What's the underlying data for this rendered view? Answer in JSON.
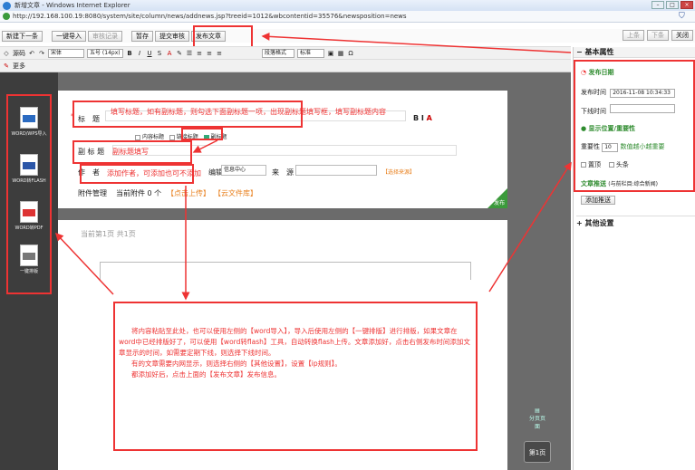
{
  "window": {
    "title": "新增文章 - Windows Internet Explorer",
    "url": "http://192.168.100.19:8080/system/site/column/news/addnews.jsp?treeid=1012&wbcontentid=35576&newsposition=news"
  },
  "toolbar": {
    "new_next": "新建下一条",
    "import": "一键导入",
    "view_record": "审核记录",
    "save_draft": "暂存",
    "submit_review": "提交审核",
    "publish": "发布文章",
    "prev": "上条",
    "next": "下条",
    "close": "关闭"
  },
  "editor_toolbar": {
    "source": "源码",
    "font": "宋体",
    "size": "五号 (14px)",
    "para": "段落格式",
    "style": "标准",
    "more": "更多"
  },
  "form": {
    "title_label": "标　题",
    "title_annotation": "填写标题，如有副标题，则勾选下面副标题一项，出现副标题填写框，填写副标题内容",
    "checks": [
      "内容标题",
      "链接标题",
      "副标题"
    ],
    "subtitle_label": "副 标 题",
    "subtitle_annotation": "副标题填写",
    "author_label": "作　者",
    "author_annotation": "添加作者，可添加也可不添加",
    "editor_label": "编辑",
    "editor_value": "信息中心",
    "source_label": "来　源",
    "choose_source": "【选择来源】",
    "attachment_label": "附件管理",
    "attachment_count": "当前附件 0 个",
    "upload": "【点击上传】",
    "cloud": "【云文件库】",
    "publish_corner": "发布"
  },
  "page_info": "当前第1页  共1页",
  "main_annotation": [
    "将内容粘贴至此处，也可以使用左侧的【word导入】，导入后使用左侧的【一键排版】进行排版，如果文章在word中已经排版好了，可以使用【word转flash】工具，自动转换flash上传。文章添加好，点击右侧发布时间添加文章显示的时间，如需要定期下线，则选择下线时间。",
    "有的文章需要内网显示，则选择右侧的【其他设置】，设置【ip规则】。",
    "都添加好后，点击上面的【发布文章】发布信息。"
  ],
  "side_tools": [
    "WORD/WPS导入",
    "WORD转FLASH",
    "WORD转PDF",
    "一键排版"
  ],
  "right": {
    "basic_props": "基本属性",
    "publish_date_title": "发布日期",
    "publish_time_label": "发布时间",
    "publish_time_value": "2016-11-08 10:34:33",
    "offline_label": "下线时间",
    "display_title": "显示位置/重要性",
    "importance_label": "重要性",
    "importance_value": "10",
    "importance_hint": "数值越小越重要",
    "top_label": "置顶",
    "headline_label": "头条",
    "push_title": "文章推送",
    "push_hint": "(与前栏目:综合新闻)",
    "add_push": "添加推送",
    "other": "其他设置"
  },
  "footer": {
    "pager_label": "分页页面",
    "page1": "第1页"
  },
  "colors": {
    "annotation_red": "#ee3333",
    "link_orange": "#e8801e",
    "green": "#2e8b2e"
  }
}
